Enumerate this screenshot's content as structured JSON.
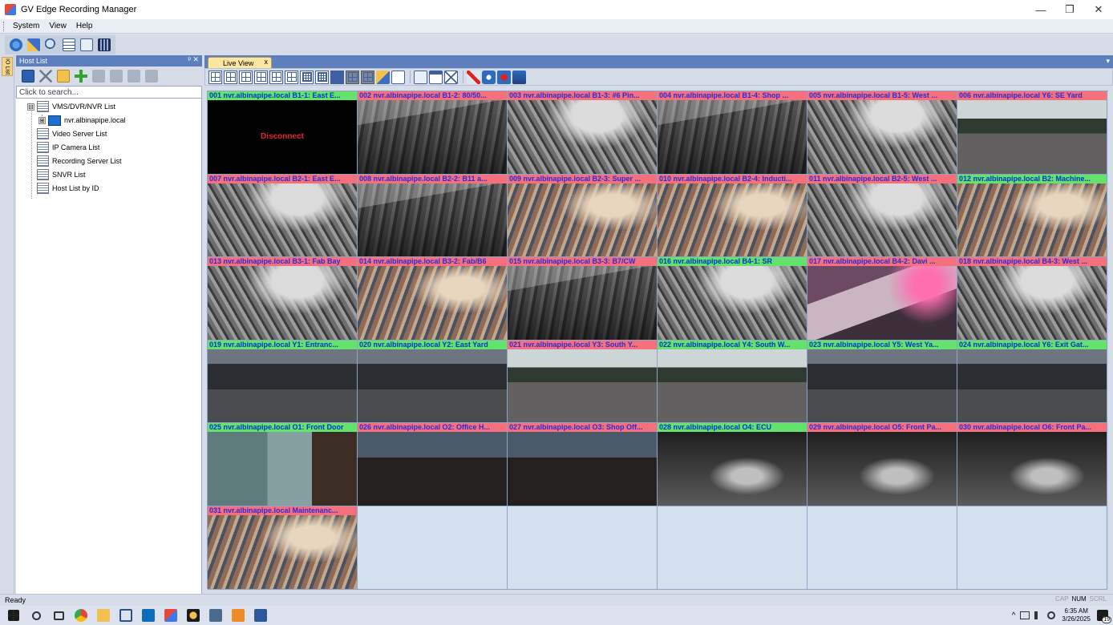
{
  "window": {
    "title": "GV Edge Recording Manager",
    "controls": {
      "minimize": "—",
      "maximize": "❐",
      "close": "✕"
    }
  },
  "menu": {
    "items": [
      "System",
      "View",
      "Help"
    ]
  },
  "main_toolbar": {
    "icons": [
      "system-config-icon",
      "tools-icon",
      "search-icon",
      "host-list-icon",
      "video-server-icon",
      "live-view-icon"
    ]
  },
  "left_panel": {
    "header": "Host List",
    "header_controls": "ᵖ ✕",
    "side_tab": "IO List",
    "search_placeholder": "Click to search...",
    "tree": [
      {
        "label": "VMS/DVR/NVR List",
        "expander": "⊟"
      },
      {
        "label": "nvr.albinapipe.local",
        "expander": "⊞"
      },
      {
        "label": "Video Server List"
      },
      {
        "label": "IP Camera List"
      },
      {
        "label": "Recording Server List"
      },
      {
        "label": "SNVR List"
      },
      {
        "label": "Host List by ID"
      }
    ]
  },
  "live_view": {
    "tab_label": "Live View",
    "tab_close": "x",
    "tab_arrow": "▾",
    "cameras": [
      {
        "label": "001  nvr.albinapipe.local B1-1: East E...",
        "status": "green",
        "feed": "disconnect",
        "message": "Disconnect"
      },
      {
        "label": "002  nvr.albinapipe.local B1-2: 80/50...",
        "status": "pink",
        "feed": "shop"
      },
      {
        "label": "003  nvr.albinapipe.local B1-3: #6 Pin...",
        "status": "pink",
        "feed": "shop2"
      },
      {
        "label": "004  nvr.albinapipe.local B1-4: Shop ...",
        "status": "pink",
        "feed": "shop"
      },
      {
        "label": "005  nvr.albinapipe.local B1-5: West ...",
        "status": "pink",
        "feed": "shop2"
      },
      {
        "label": "006  nvr.albinapipe.local Y6: SE Yard",
        "status": "pink",
        "feed": "yardlight"
      },
      {
        "label": "007  nvr.albinapipe.local B2-1: East E...",
        "status": "pink",
        "feed": "shop2"
      },
      {
        "label": "008  nvr.albinapipe.local B2-2: B11 a...",
        "status": "pink",
        "feed": "shop"
      },
      {
        "label": "009  nvr.albinapipe.local B2-3: Super ...",
        "status": "pink",
        "feed": "shopcolor"
      },
      {
        "label": "010  nvr.albinapipe.local B2-4: Inducti...",
        "status": "pink",
        "feed": "shopcolor"
      },
      {
        "label": "011  nvr.albinapipe.local B2-5: West ...",
        "status": "pink",
        "feed": "shop2"
      },
      {
        "label": "012  nvr.albinapipe.local B2: Machine...",
        "status": "green",
        "feed": "shopcolor"
      },
      {
        "label": "013  nvr.albinapipe.local B3-1: Fab Bay",
        "status": "pink",
        "feed": "shop2"
      },
      {
        "label": "014  nvr.albinapipe.local B3-2: Fab/B6",
        "status": "pink",
        "feed": "shopcolor"
      },
      {
        "label": "015  nvr.albinapipe.local B3-3: B7/CW",
        "status": "pink",
        "feed": "shop"
      },
      {
        "label": "016  nvr.albinapipe.local B4-1: SR",
        "status": "green",
        "feed": "shop2"
      },
      {
        "label": "017  nvr.albinapipe.local B4-2: Davi ...",
        "status": "pink",
        "feed": "pinkshop"
      },
      {
        "label": "018  nvr.albinapipe.local B4-3: West ...",
        "status": "pink",
        "feed": "shop2"
      },
      {
        "label": "019  nvr.albinapipe.local Y1: Entranc...",
        "status": "green",
        "feed": "yard"
      },
      {
        "label": "020  nvr.albinapipe.local Y2: East Yard",
        "status": "green",
        "feed": "yard"
      },
      {
        "label": "021  nvr.albinapipe.local Y3:  South Y...",
        "status": "pink",
        "feed": "yardlight"
      },
      {
        "label": "022  nvr.albinapipe.local Y4: South W...",
        "status": "green",
        "feed": "yardlight"
      },
      {
        "label": "023  nvr.albinapipe.local Y5: West Ya...",
        "status": "green",
        "feed": "yard"
      },
      {
        "label": "024  nvr.albinapipe.local Y6: Exit Gat...",
        "status": "green",
        "feed": "yard"
      },
      {
        "label": "025  nvr.albinapipe.local O1: Front Door",
        "status": "green",
        "feed": "office"
      },
      {
        "label": "026  nvr.albinapipe.local O2: Office H...",
        "status": "pink",
        "feed": "officedark"
      },
      {
        "label": "027  nvr.albinapipe.local O3: Shop Off...",
        "status": "pink",
        "feed": "officedark"
      },
      {
        "label": "028  nvr.albinapipe.local O4: ECU",
        "status": "green",
        "feed": "night"
      },
      {
        "label": "029  nvr.albinapipe.local O5: Front Pa...",
        "status": "pink",
        "feed": "night"
      },
      {
        "label": "030  nvr.albinapipe.local O6: Front Pa...",
        "status": "pink",
        "feed": "night"
      },
      {
        "label": "031  nvr.albinapipe.local Maintenanc...",
        "status": "pink",
        "feed": "shopcolor"
      },
      {
        "label": "",
        "status": "none",
        "feed": "empty"
      },
      {
        "label": "",
        "status": "none",
        "feed": "empty"
      },
      {
        "label": "",
        "status": "none",
        "feed": "empty"
      },
      {
        "label": "",
        "status": "none",
        "feed": "empty"
      },
      {
        "label": "",
        "status": "none",
        "feed": "empty"
      }
    ]
  },
  "status_bar": {
    "text": "Ready",
    "indicators": [
      {
        "label": "CAP",
        "on": false
      },
      {
        "label": "NUM",
        "on": true
      },
      {
        "label": "SCRL",
        "on": false
      }
    ]
  },
  "taskbar": {
    "tray_chevron": "^",
    "time": "6:35 AM",
    "date": "3/26/2025",
    "notifications": "19"
  },
  "colors": {
    "label_green": "#63e36b",
    "label_pink": "#f56f7c",
    "header_blue": "#5d7fbf",
    "disconnect_text": "#e0282c"
  }
}
